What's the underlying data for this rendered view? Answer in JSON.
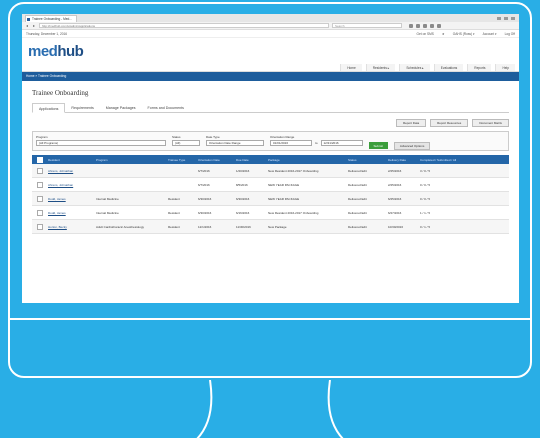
{
  "browser": {
    "tab_title": "Trainee Onboarding - Med...",
    "url": "http://medhub.com/u/admin/applications",
    "search_placeholder": "Search"
  },
  "top": {
    "date": "Thursday, December 1, 2016",
    "links": [
      "Get on SMS",
      "★",
      "OAHS (Ross) ▾",
      "Account ▾",
      "Log Off"
    ]
  },
  "logo": {
    "med": "med",
    "hub": "hub"
  },
  "nav": [
    "Home",
    "Residents ▸",
    "Schedules ▸",
    "Evaluations",
    "Reports",
    "Help"
  ],
  "breadcrumb": "Home » Trainee Onboarding",
  "page_title": "Trainee Onboarding",
  "subtabs": [
    "Applications",
    "Requirements",
    "Manage Packages",
    "Forms and Documents"
  ],
  "actions": [
    "Report Data",
    "Report Resources",
    "Document Matrix"
  ],
  "filters": {
    "program_label": "Program",
    "program_value": "(All Programs)",
    "status_label": "Status",
    "status_value": "(All)",
    "datetype_label": "Date Type",
    "datetype_value": "Orientation Date Range",
    "range_label": "Orientation Range",
    "range_from": "01/01/2016",
    "range_to_word": "to",
    "range_to": "12/31/2016",
    "submit": "Submit",
    "advanced": "Advanced Options"
  },
  "table": {
    "headers": [
      "Resident",
      "Program",
      "Trainee Type",
      "Orientation Date",
      "Due Date",
      "Package",
      "Status",
      "Delivery Date",
      "Completed / Submitted / All"
    ],
    "rows": [
      [
        "Ahrens, Johnathan",
        "",
        "",
        "6/7/2016",
        "1/20/2016",
        "New Resident 2016-2017 Onboarding",
        "Delivered Edit",
        "2/25/2016",
        "3 / 0 / 5"
      ],
      [
        "Ahrens, Johnathan",
        "",
        "",
        "6/7/2016",
        "8/5/2016",
        "NEW YEAR PACKAGE",
        "Delivered Edit",
        "2/25/2016",
        "0 / 0 / 5"
      ],
      [
        "Dodd, James",
        "Internal Medicine",
        "Resident",
        "6/30/2016",
        "6/30/2016",
        "NEW YEAR PACKAGE",
        "Delivered Edit",
        "6/25/2016",
        "0 / 0 / 5"
      ],
      [
        "Dodd, James",
        "Internal Medicine",
        "Resident",
        "6/30/2016",
        "6/16/2016",
        "New Resident 2016-2017 Onboarding",
        "Delivered Edit",
        "6/27/2016",
        "1 / 1 / 5"
      ],
      [
        "Horton, Becky",
        "Adult Cardiothoracic Anesthesiology",
        "Resident",
        "12/1/2016",
        "11/30/2016",
        "New Package",
        "Delivered Edit",
        "10/30/2016",
        "0 / 1 / 5"
      ]
    ]
  }
}
